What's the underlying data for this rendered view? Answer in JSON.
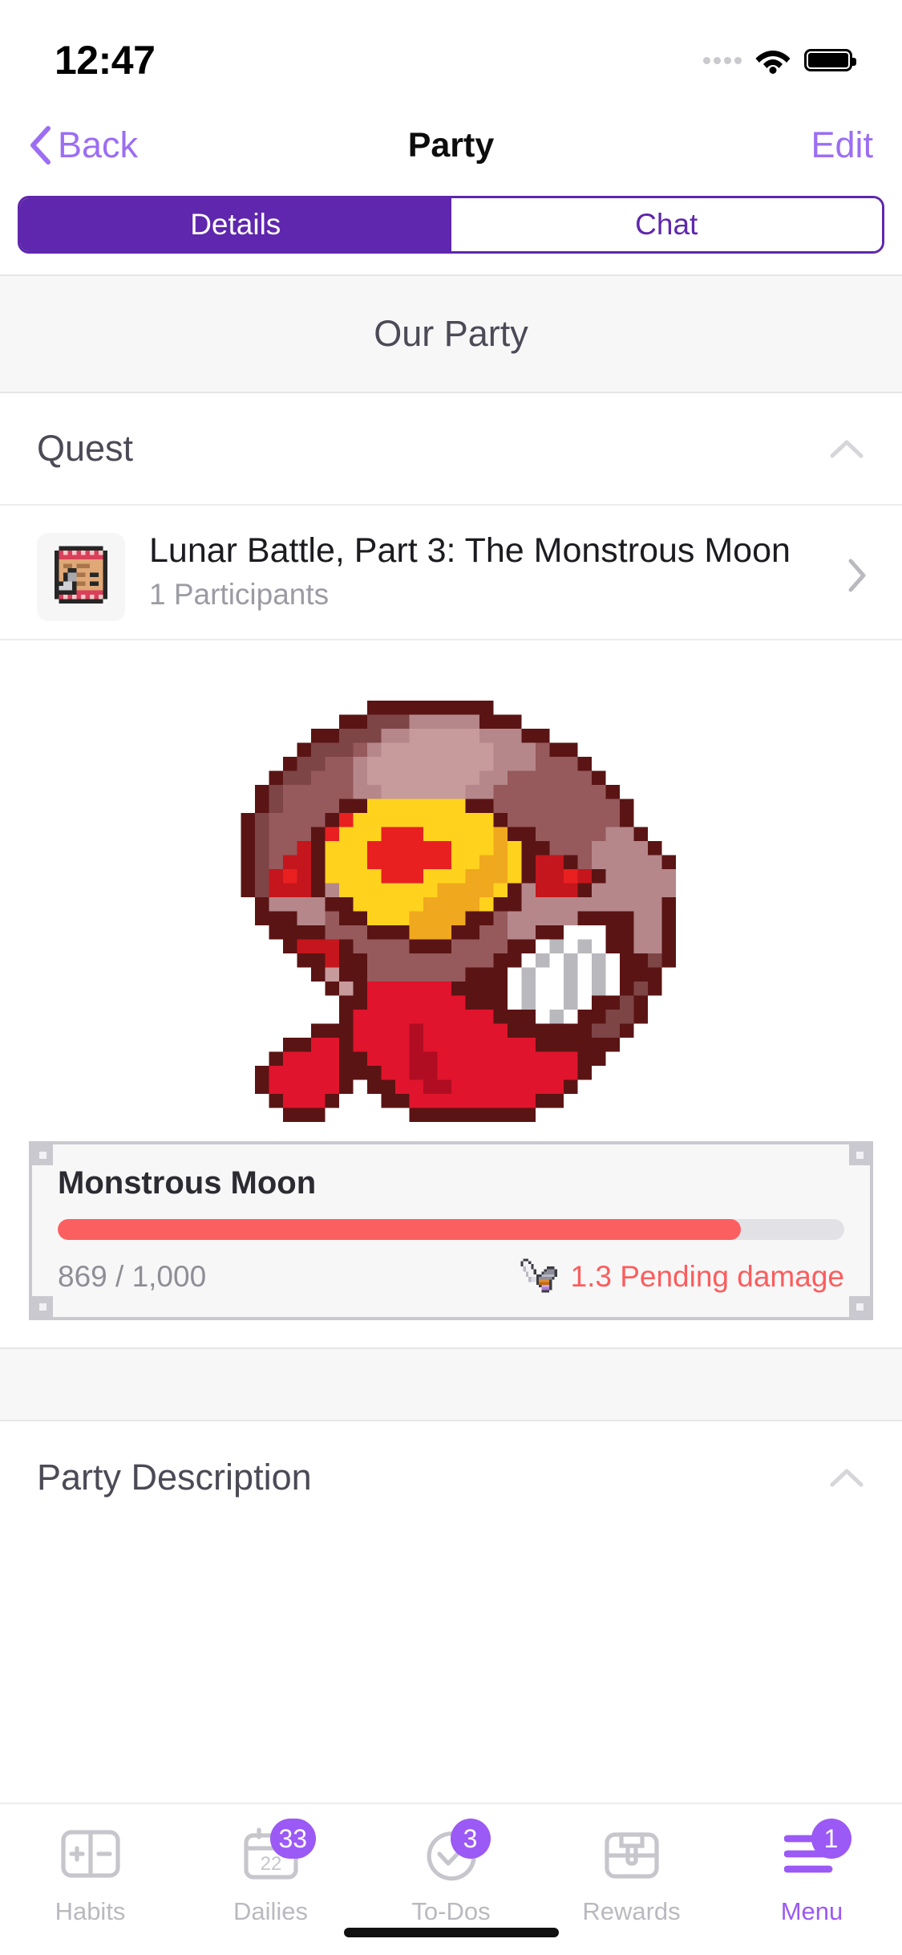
{
  "status_bar": {
    "time": "12:47",
    "signal_icon": "signal-dots-icon",
    "wifi_icon": "wifi-icon",
    "battery_icon": "battery-full-icon"
  },
  "nav": {
    "back_label": "Back",
    "back_icon": "chevron-left-icon",
    "title": "Party",
    "edit_label": "Edit"
  },
  "segmented": {
    "tabs": [
      {
        "label": "Details",
        "active": true
      },
      {
        "label": "Chat",
        "active": false
      }
    ],
    "active_color": "#5f27ad",
    "inactive_text_color": "#5f27ad"
  },
  "banner": {
    "title": "Our Party"
  },
  "quest_section": {
    "title": "Quest",
    "collapse_icon": "chevron-up-icon",
    "item": {
      "icon": "quest-scroll-icon",
      "name": "Lunar Battle, Part 3: The Monstrous Moon",
      "participants": "1 Participants",
      "disclosure_icon": "chevron-right-icon"
    }
  },
  "boss": {
    "art_icon": "monstrous-moon-pixel-art",
    "name": "Monstrous Moon",
    "hp_current": 869,
    "hp_max": 1000,
    "hp_text": "869 / 1,000",
    "hp_percent": 86.9,
    "hp_bar_color": "#fc5f5f",
    "hp_track_color": "#e2e2e6",
    "pending_damage_icon": "sword-icon",
    "pending_damage_text": "1.3 Pending damage",
    "pending_damage_color": "#fb5d5d"
  },
  "description_section": {
    "title": "Party Description",
    "collapse_icon": "chevron-up-icon"
  },
  "tabbar": {
    "accent_color": "#9b59f5",
    "inactive_color": "#b9b9bf",
    "items": [
      {
        "label": "Habits",
        "icon": "habits-plus-minus-icon",
        "badge": "",
        "active": false
      },
      {
        "label": "Dailies",
        "icon": "calendar-icon",
        "badge": "33",
        "active": false,
        "calendar_day": "22"
      },
      {
        "label": "To-Dos",
        "icon": "check-circle-icon",
        "badge": "3",
        "active": false
      },
      {
        "label": "Rewards",
        "icon": "treasure-chest-icon",
        "badge": "",
        "active": false
      },
      {
        "label": "Menu",
        "icon": "hamburger-menu-icon",
        "badge": "1",
        "active": true
      }
    ]
  }
}
